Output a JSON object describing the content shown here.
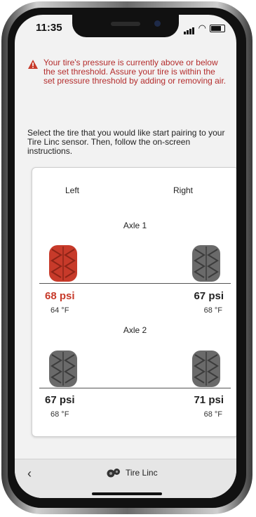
{
  "status_bar": {
    "time": "11:35"
  },
  "warning": {
    "text": "Your tire's pressure is currently above or below the set threshold. Assure your tire is within the set pressure threshold by adding or removing air."
  },
  "instructions": "Select the tire that you would like start pairing to your Tire Linc sensor. Then, follow the on-screen instructions.",
  "columns": {
    "left": "Left",
    "right": "Right"
  },
  "axles": [
    {
      "title": "Axle 1",
      "left": {
        "psi": "68 psi",
        "temp": "64 °F",
        "alert": true
      },
      "right": {
        "psi": "67 psi",
        "temp": "68 °F",
        "alert": false
      }
    },
    {
      "title": "Axle 2",
      "left": {
        "psi": "67 psi",
        "temp": "68 °F",
        "alert": false
      },
      "right": {
        "psi": "71 psi",
        "temp": "68 °F",
        "alert": false
      }
    }
  ],
  "bottom_bar": {
    "app_name": "Tire Linc"
  },
  "colors": {
    "alert": "#c73a2a",
    "warning_text": "#b42d2d",
    "tire_normal": "#6a6a6a"
  }
}
